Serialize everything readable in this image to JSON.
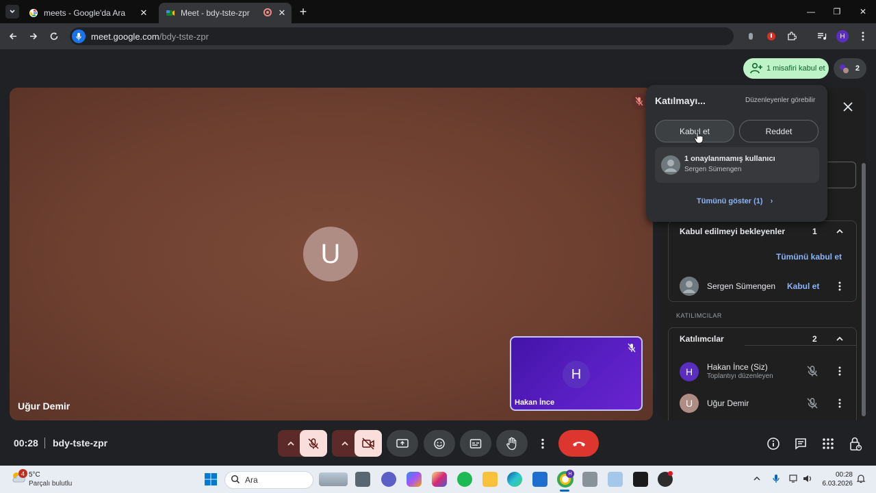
{
  "browser": {
    "tabs": [
      {
        "title": "meets - Google'da Ara"
      },
      {
        "title": "Meet - bdy-tste-zpr"
      }
    ],
    "url_host": "meet.google.com",
    "url_path": "/bdy-tste-zpr",
    "profile_initial": "H"
  },
  "meet": {
    "stage": {
      "name": "Uğur Demir",
      "avatar_letter": "U"
    },
    "self_tile": {
      "name": "Hakan İnce",
      "avatar_letter": "H"
    },
    "admit_chip": "1 misafiri kabul et",
    "participant_count": "2",
    "popup": {
      "title": "Katılmayı...",
      "note": "Düzenleyenler görebilir",
      "accept": "Kabul et",
      "reject": "Reddet",
      "user_title": "1 onaylanmamış kullanıcı",
      "user_sub": "Sergen Sümengen",
      "show_all": "Tümünü göster (1)"
    },
    "waiting": {
      "title": "Kabul edilmeyi bekleyenler",
      "count": "1",
      "accept_all": "Tümünü kabul et",
      "person": "Sergen Sümengen",
      "accept": "Kabul et"
    },
    "category_label": "KATILIMCILAR",
    "participants": {
      "title": "Katılımcılar",
      "count": "2",
      "items": [
        {
          "name": "Hakan İnce (Siz)",
          "sub": "Toplantıyı düzenleyen",
          "letter": "H"
        },
        {
          "name": "Uğur Demir",
          "sub": "",
          "letter": "U"
        }
      ]
    },
    "clock": "00:28",
    "meeting_code": "bdy-tste-zpr"
  },
  "taskbar": {
    "temperature": "5°C",
    "weather": "Parçalı bulutlu",
    "weather_badge": "4",
    "search_placeholder": "Ara",
    "time": "00:28",
    "date": "6.03.2026"
  },
  "colors": {
    "admit_green": "#bdf3c7",
    "end_call": "#dc362e",
    "link_blue": "#8ab4f8"
  }
}
